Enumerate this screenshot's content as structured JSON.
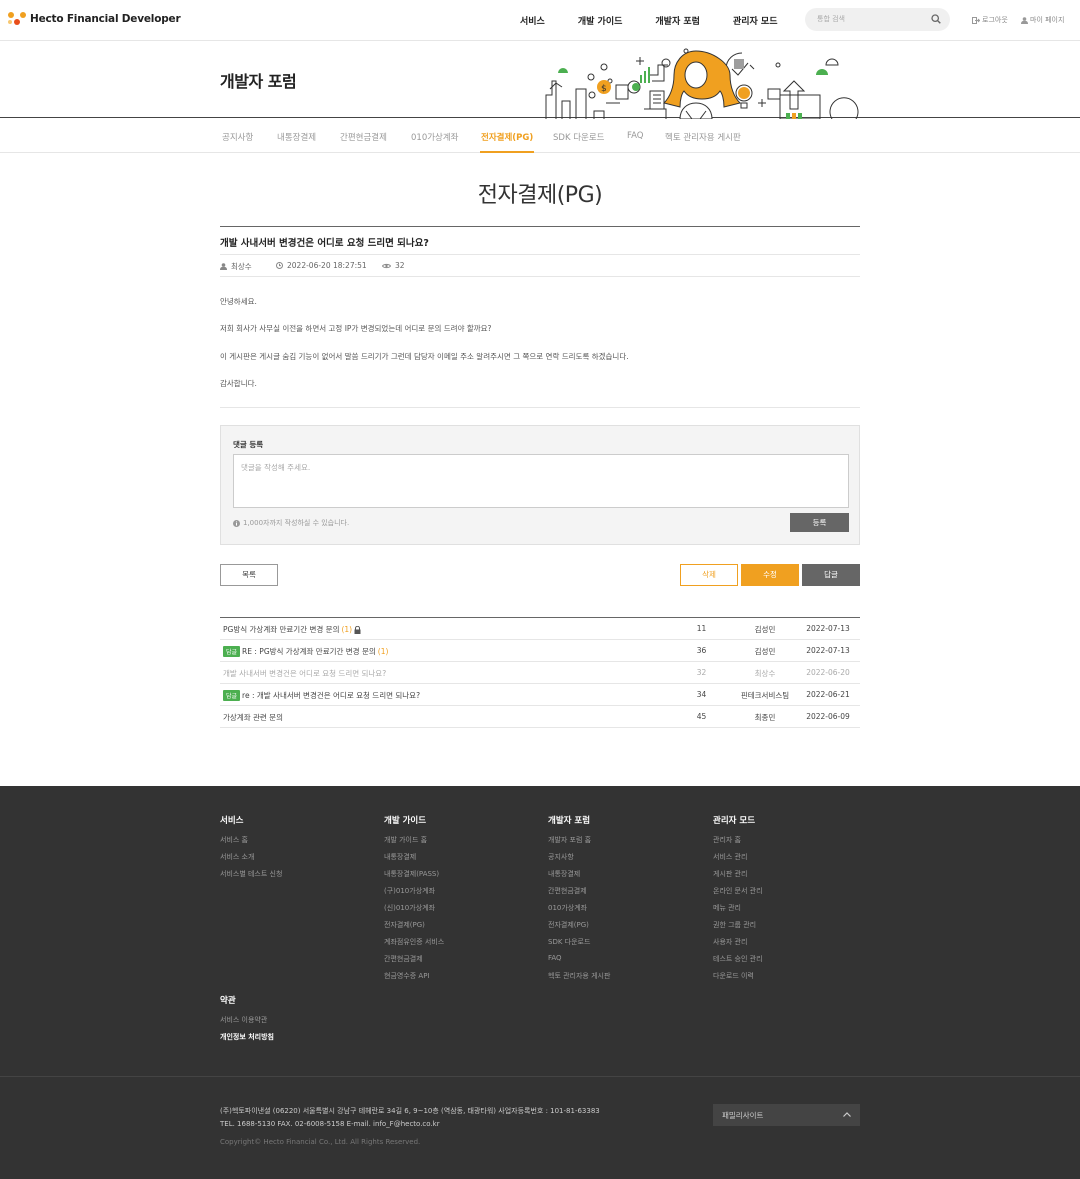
{
  "header": {
    "logo_text": "Hecto Financial Developer",
    "nav": [
      "서비스",
      "개발 가이드",
      "개발자 포럼",
      "관리자 모드"
    ],
    "search_placeholder": "통합 검색",
    "logout": "로그아웃",
    "mypage": "마이 페이지"
  },
  "visual": {
    "title": "개발자 포럼"
  },
  "tabs": [
    "공지사항",
    "내통장결제",
    "간편현금결제",
    "010가상계좌",
    "전자결제(PG)",
    "SDK 다운로드",
    "FAQ",
    "헥토 관리자용 게시판"
  ],
  "active_tab": "전자결제(PG)",
  "page_title": "전자결제(PG)",
  "post": {
    "title": "개발 사내서버 변경건은 어디로 요청 드리면 되나요?",
    "author": "최상수",
    "datetime": "2022-06-20 18:27:51",
    "views": "32",
    "body": [
      "안녕하세요.",
      "저희 회사가 사무실 이전을 하면서 고정 IP가 변경되었는데 어디로 문의 드려야 할까요?",
      "이 게시판은 게시글 숨김 기능이 없어서 말씀 드리기가 그런데 담당자 이메일 주소 알려주시면 그 쪽으로 연락 드리도록 하겠습니다.",
      "감사합니다."
    ]
  },
  "comment": {
    "label": "댓글 등록",
    "placeholder": "댓글을 작성해 주세요.",
    "note": "1,000자까지 작성하실 수 있습니다.",
    "submit": "등록"
  },
  "buttons": {
    "list": "목록",
    "delete": "삭제",
    "edit": "수정",
    "reply": "답글"
  },
  "list": [
    {
      "badge": "",
      "title": "PG방식 가상계좌 만료기간 변경 문의",
      "count": "(1)",
      "locked": true,
      "views": "11",
      "author": "김성민",
      "date": "2022-07-13",
      "current": false
    },
    {
      "badge": "답글",
      "title": "RE : PG방식 가상계좌 만료기간 변경 문의",
      "count": "(1)",
      "locked": false,
      "views": "36",
      "author": "김성민",
      "date": "2022-07-13",
      "current": false
    },
    {
      "badge": "",
      "title": "개발 사내서버 변경건은 어디로 요청 드리면 되나요?",
      "count": "",
      "locked": false,
      "views": "32",
      "author": "최상수",
      "date": "2022-06-20",
      "current": true
    },
    {
      "badge": "답글",
      "title": "re : 개발 사내서버 변경건은 어디로 요청 드리면 되나요?",
      "count": "",
      "locked": false,
      "views": "34",
      "author": "핀테크서비스팀",
      "date": "2022-06-21",
      "current": false
    },
    {
      "badge": "",
      "title": "가상계좌 관련 문의",
      "count": "",
      "locked": false,
      "views": "45",
      "author": "최종민",
      "date": "2022-06-09",
      "current": false
    }
  ],
  "footer": {
    "columns": [
      {
        "title": "서비스",
        "items": [
          "서비스 홈",
          "서비스 소개",
          "서비스별 테스트 신청"
        ]
      },
      {
        "title": "개발 가이드",
        "items": [
          "개발 가이드 홈",
          "내통장결제",
          "내통장결제(PASS)",
          "(구)010가상계좌",
          "(신)010가상계좌",
          "전자결제(PG)",
          "계좌점유인증 서비스",
          "간편현금결제",
          "현금영수증 API"
        ]
      },
      {
        "title": "개발자 포럼",
        "items": [
          "개발자 포럼 홈",
          "공지사항",
          "내통장결제",
          "간편현금결제",
          "010가상계좌",
          "전자결제(PG)",
          "SDK 다운로드",
          "FAQ",
          "헥토 관리자용 게시판"
        ]
      },
      {
        "title": "관리자 모드",
        "items": [
          "관리자 홈",
          "서비스 관리",
          "게시판 관리",
          "온라인 문서 관리",
          "메뉴 관리",
          "권한 그룹 관리",
          "사용자 관리",
          "테스트 승인 관리",
          "다운로드 이력"
        ]
      }
    ],
    "terms_title": "약관",
    "terms": [
      "서비스 이용약관",
      "개인정보 처리방침"
    ],
    "company_line": "(주)헥토파이낸셜      (06220) 서울특별시 강남구 테헤란로 34길 6, 9~10층 (역삼동, 태광타워)      사업자등록번호 : 101-81-63383",
    "contact_line": "TEL. 1688-5130      FAX. 02-6008-5158      E-mail. info_F@hecto.co.kr",
    "copyright": "Copyright© Hecto Financial Co., Ltd. All Rights Reserved.",
    "family_site": "패밀리사이트"
  },
  "colors": {
    "accent": "#f0a020",
    "badge": "#4caf50",
    "footer_bg": "#333333",
    "dark_button": "#666666"
  }
}
